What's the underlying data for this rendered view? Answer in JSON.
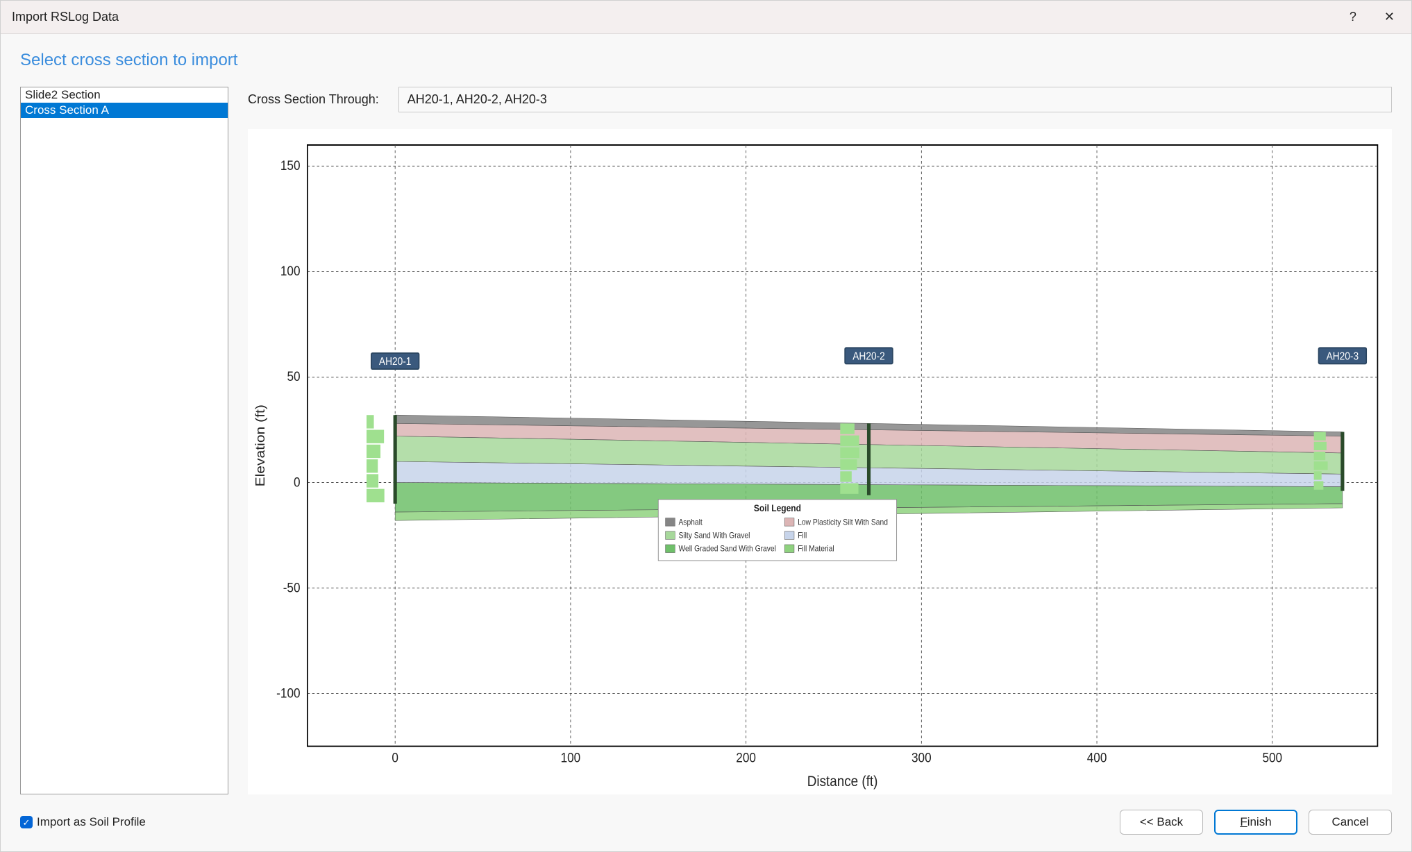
{
  "window": {
    "title": "Import RSLog Data"
  },
  "heading": "Select cross section to import",
  "sections": {
    "items": [
      "Slide2 Section",
      "Cross Section A"
    ],
    "selected_index": 1
  },
  "through": {
    "label": "Cross Section Through:",
    "value": "AH20-1, AH20-2, AH20-3"
  },
  "chart_data": {
    "type": "line",
    "xlabel": "Distance (ft)",
    "ylabel": "Elevation (ft)",
    "xlim": [
      -50,
      560
    ],
    "ylim": [
      -125,
      160
    ],
    "xticks": [
      0,
      100,
      200,
      300,
      400,
      500
    ],
    "yticks": [
      -100,
      -50,
      0,
      50,
      100,
      150
    ],
    "boreholes": [
      {
        "name": "AH20-1",
        "x": 0,
        "top": 32,
        "bottom": -10
      },
      {
        "name": "AH20-2",
        "x": 270,
        "top": 28,
        "bottom": -6
      },
      {
        "name": "AH20-3",
        "x": 540,
        "top": 24,
        "bottom": -4
      }
    ],
    "strata": [
      {
        "name": "Asphalt",
        "color": "#858585",
        "top_left": 32,
        "top_right": 24,
        "bot_left": 28,
        "bot_right": 22
      },
      {
        "name": "Low Plasticity Silt With Sand",
        "color": "#dcb5b5",
        "top_left": 28,
        "top_right": 22,
        "bot_left": 22,
        "bot_right": 14
      },
      {
        "name": "Silty Sand With Gravel",
        "color": "#a7d89b",
        "top_left": 22,
        "top_right": 14,
        "bot_left": 10,
        "bot_right": 4
      },
      {
        "name": "Fill",
        "color": "#c7d4ea",
        "top_left": 10,
        "top_right": 4,
        "bot_left": 0,
        "bot_right": -2
      },
      {
        "name": "Well Graded Sand With Gravel",
        "color": "#6fc06a",
        "top_left": 0,
        "top_right": -2,
        "bot_left": -14,
        "bot_right": -10
      },
      {
        "name": "Fill Material",
        "color": "#8fd27f",
        "top_left": -14,
        "top_right": -10,
        "bot_left": -18,
        "bot_right": -12
      }
    ],
    "legend_title": "Soil Legend",
    "legend": [
      {
        "swatch": "#858585",
        "label": "Asphalt"
      },
      {
        "swatch": "#a7d89b",
        "label": "Silty Sand With Gravel"
      },
      {
        "swatch": "#6fc06a",
        "label": "Well Graded Sand With Gravel"
      },
      {
        "swatch": "#dcb5b5",
        "label": "Low Plasticity Silt With Sand"
      },
      {
        "swatch": "#c7d4ea",
        "label": "Fill"
      },
      {
        "swatch": "#8fd27f",
        "label": "Fill Material"
      }
    ]
  },
  "footer": {
    "checkbox_label": "Import as Soil Profile",
    "checkbox_checked": true,
    "back_label": "<< Back",
    "finish_label": "Finish",
    "cancel_label": "Cancel"
  }
}
